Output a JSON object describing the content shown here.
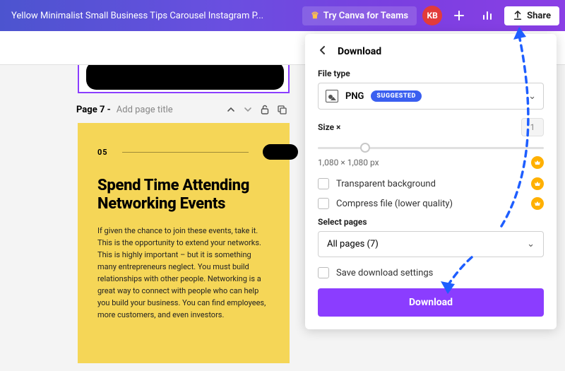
{
  "topbar": {
    "doc_title": "Yellow Minimalist Small Business Tips Carousel Instagram P...",
    "teams_label": "Try Canva for Teams",
    "avatar_initials": "KB",
    "share_label": "Share"
  },
  "page_header": {
    "label": "Page 7 -",
    "placeholder": "Add page title"
  },
  "canvas_page": {
    "number": "05",
    "heading": "Spend Time Attending Networking Events",
    "body": "If given the chance to join these events, take it. This is the opportunity to extend your networks. This is highly important – but it is something many entrepreneurs neglect. You must build relationships with other people. Networking is a great way to connect with people who can help you build your business. You can find employees, more customers, and even investors."
  },
  "download_panel": {
    "title": "Download",
    "file_type_label": "File type",
    "file_type_value": "PNG",
    "suggested_badge": "SUGGESTED",
    "size_label": "Size ×",
    "size_value": "1",
    "dimensions": "1,080 × 1,080 px",
    "transparent_label": "Transparent background",
    "compress_label": "Compress file (lower quality)",
    "select_pages_label": "Select pages",
    "select_pages_value": "All pages (7)",
    "save_settings_label": "Save download settings",
    "download_button": "Download"
  }
}
